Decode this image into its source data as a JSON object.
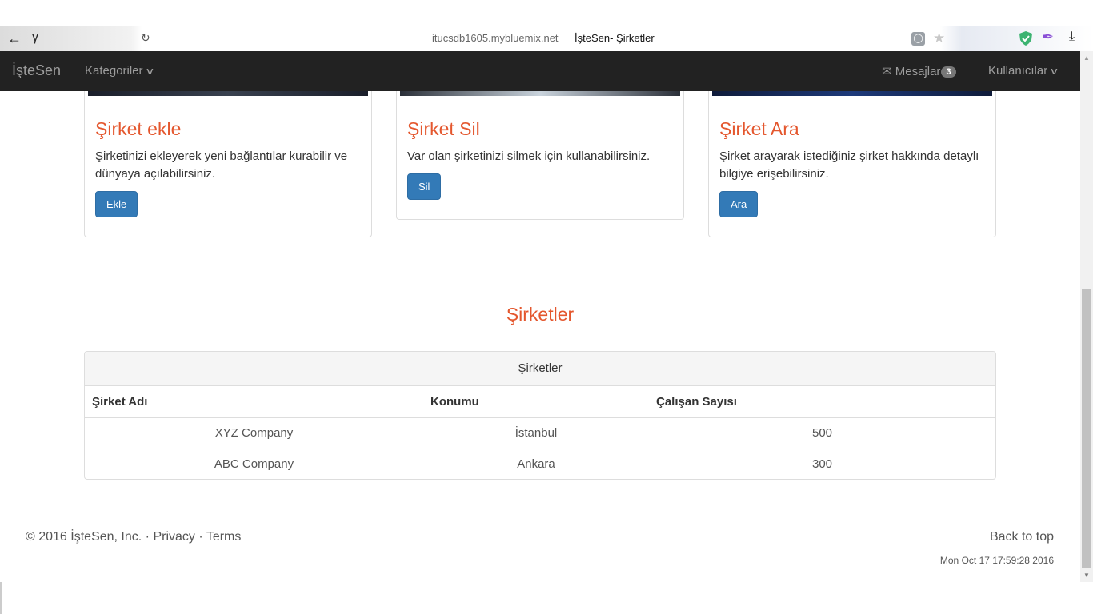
{
  "browser": {
    "ext_glyph": "γ",
    "url": "itucsdb1605.mybluemix.net",
    "tab_title": "İşteSen- Şirketler"
  },
  "navbar": {
    "brand": "İşteSen",
    "categories_label": "Kategoriler",
    "messages_label": "Mesajlar",
    "messages_count": "3",
    "users_label": "Kullanıcılar"
  },
  "cards": [
    {
      "title": "Şirket ekle",
      "text": "Şirketinizi ekleyerek yeni bağlantılar kurabilir ve dünyaya açılabilirsiniz.",
      "button": "Ekle"
    },
    {
      "title": "Şirket Sil",
      "text": "Var olan şirketinizi silmek için kullanabilirsiniz.",
      "button": "Sil"
    },
    {
      "title": "Şirket Ara",
      "text": "Şirket arayarak istediğiniz şirket hakkında detaylı bilgiye erişebilirsiniz.",
      "button": "Ara"
    }
  ],
  "section_title": "Şirketler",
  "table": {
    "caption": "Şirketler",
    "headers": [
      "Şirket Adı",
      "Konumu",
      "Çalışan Sayısı"
    ],
    "rows": [
      [
        "XYZ Company",
        "İstanbul",
        "500"
      ],
      [
        "ABC Company",
        "Ankara",
        "300"
      ]
    ]
  },
  "footer": {
    "copyright": "© 2016 İşteSen, Inc.",
    "privacy": "Privacy",
    "terms": "Terms",
    "separator": " · ",
    "back_to_top": "Back to top",
    "timestamp": "Mon Oct 17 17:59:28 2016"
  }
}
